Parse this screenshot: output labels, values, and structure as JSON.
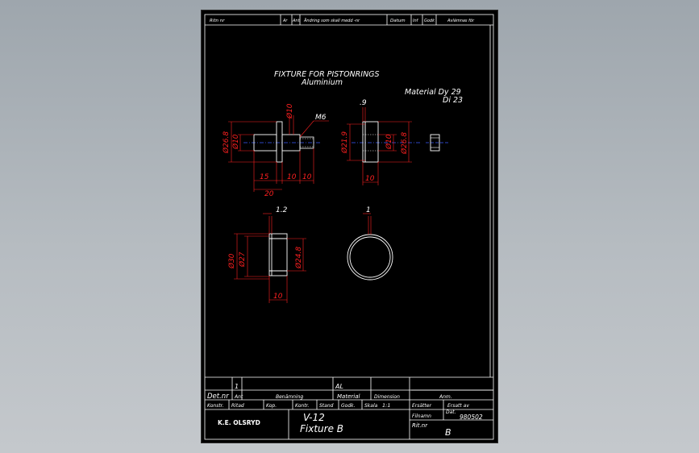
{
  "header_row": {
    "ritn_nr": "Ritn nr",
    "ar": "Ar",
    "ant": "Ant",
    "andring": "Ändring som skall medd -nr",
    "datum": "Datum",
    "inf": "Inf",
    "godk": "Godk",
    "avlamnas": "Avlämnas för"
  },
  "title_block": {
    "title_line1": "FIXTURE FOR PISTONRINGS",
    "title_line2": "Aluminium",
    "material_line1": "Material Dy 29",
    "material_line2": "Di 23"
  },
  "part1": {
    "d_flange": "Ø10",
    "thread": "M6",
    "d_outer": "Ø26.8",
    "d_shaft": "Ø10",
    "len_shaft": "15",
    "len_flange": "10",
    "len_thread": "10",
    "len_total": "20"
  },
  "part2": {
    "gap": ".9",
    "d_outer": "Ø21.9",
    "d_inner": "Ø10",
    "d_rim": "Ø26.8",
    "width": "10"
  },
  "part3": {
    "lip": "1.2",
    "d_outer": "Ø30",
    "d_mid": "Ø27",
    "d_inner": "Ø24.8",
    "width": "10"
  },
  "part4": {
    "thickness": "1"
  },
  "parts_list": {
    "row_qty": "1",
    "row_material": "AL",
    "det_nr": "Det.nr",
    "ant": "Ant",
    "benamning": "Benämning",
    "material": "Material",
    "dimension": "Dimension",
    "anm": "Anm."
  },
  "footer": {
    "konstr": "Konstr.",
    "ritad": "Ritad",
    "kop": "Kop.",
    "kontr": "Kontr.",
    "stand": "Stand",
    "godk": "Godk.",
    "skala": "Skala",
    "skala_val": "1:1",
    "ersatter": "Ersätter",
    "ersatt_av": "Ersatt av",
    "company": "K.E. OLSRYD",
    "drawing_no": "V-12",
    "drawing_name": "Fixture B",
    "filnamn": "Filnamn",
    "dat_label": "Dat.",
    "dat_val": "980502",
    "ritnr": "Rit.nr",
    "ritnr_val": "B"
  }
}
